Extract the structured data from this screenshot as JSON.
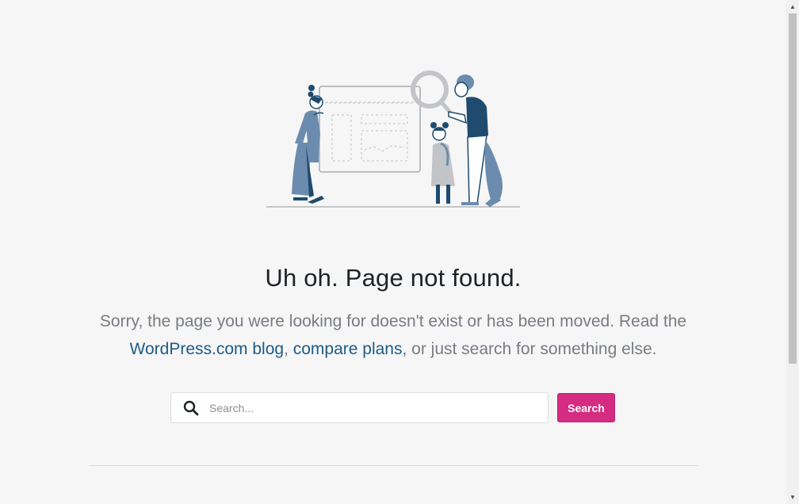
{
  "error": {
    "headline": "Uh oh. Page not found.",
    "message_part1": "Sorry, the page you were looking for doesn't exist or has been moved. Read the ",
    "link_blog": "WordPress.com blog",
    "separator": ", ",
    "link_plans": "compare plans",
    "message_part2": ", or just search for something else."
  },
  "search": {
    "placeholder": "Search...",
    "value": "",
    "button_label": "Search",
    "icon": "search-icon"
  },
  "colors": {
    "accent_button": "#d52c82",
    "link": "#1f5b85",
    "illustration_dark": "#1e4b6e",
    "illustration_mid": "#6b8cae"
  }
}
